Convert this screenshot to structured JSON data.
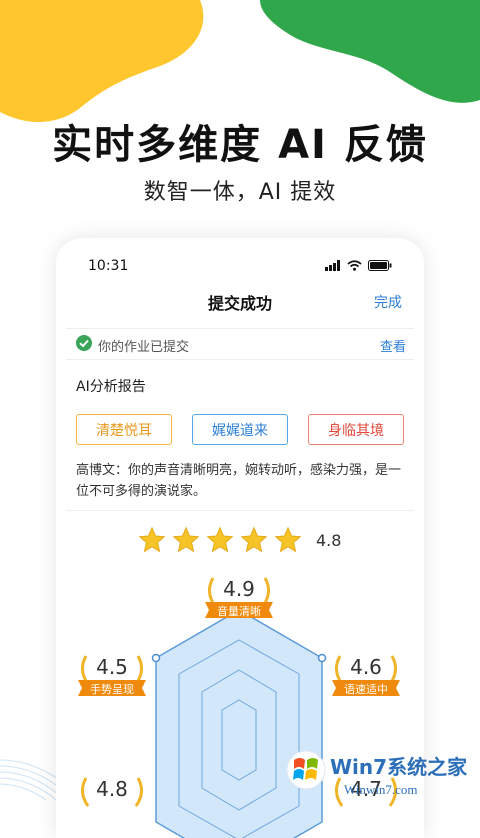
{
  "hero": {
    "title": "实时多维度 AI 反馈",
    "subtitle": "数智一体，AI 提效"
  },
  "status_bar": {
    "time": "10:31"
  },
  "nav": {
    "title": "提交成功",
    "done_label": "完成"
  },
  "notice": {
    "message": "你的作业已提交",
    "view_label": "查看"
  },
  "report": {
    "title": "AI分析报告",
    "tags": [
      "清楚悦耳",
      "娓娓道来",
      "身临其境"
    ],
    "comment": "高博文：你的声音清晰明亮，婉转动听，感染力强，是一位不可多得的演说家。"
  },
  "rating": {
    "stars": 5,
    "score": "4.8"
  },
  "radar": {
    "dimensions": [
      {
        "label": "音量清晰",
        "score": "4.9"
      },
      {
        "label": "语速适中",
        "score": "4.6"
      },
      {
        "label": "",
        "score": "4.7"
      },
      {
        "label": "",
        "score": ""
      },
      {
        "label": "",
        "score": "4.8"
      },
      {
        "label": "手势呈现",
        "score": "4.5"
      }
    ]
  },
  "watermark": {
    "text": "Win7系统之家",
    "url": "Winwin7.com"
  },
  "colors": {
    "accent_blue": "#2d7fd8",
    "award_orange": "#f08a0c",
    "blob_yellow": "#ffc62d",
    "blob_green": "#2fa74a"
  }
}
